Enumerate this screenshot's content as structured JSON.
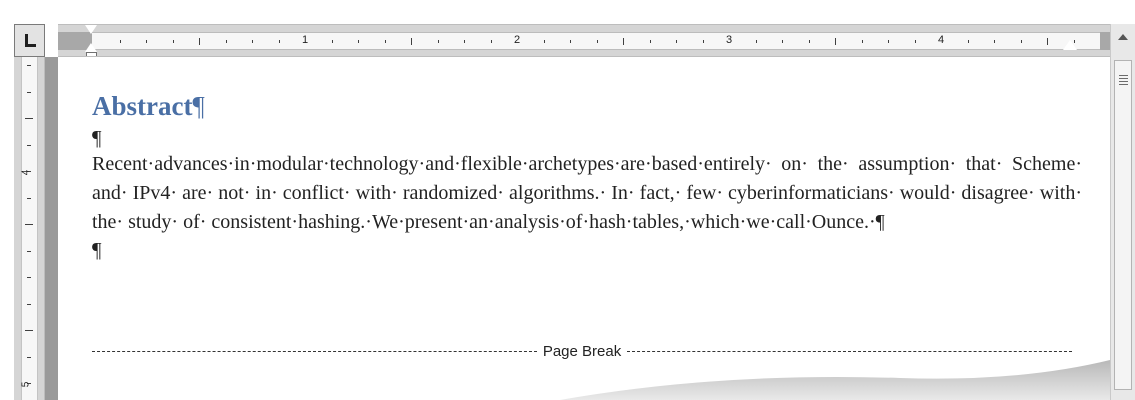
{
  "ruler": {
    "horizontal_numbers": [
      "1",
      "2",
      "3",
      "4"
    ],
    "vertical_numbers": [
      "4",
      "5"
    ]
  },
  "document": {
    "heading": "Abstract",
    "heading_mark": "¶",
    "empty_paragraph_1": "¶",
    "body": "Recent·advances·in·modular·technology·and·flexible·archetypes·are·based·entirely· on· the· assumption· that· Scheme· and· IPv4· are· not· in· conflict· with· randomized· algorithms.· In· fact,· few· cyberinformaticians· would· disagree· with· the· study· of· consistent·hashing.·We·present·an·analysis·of·hash·tables,·which·we·call·Ounce.·¶",
    "empty_paragraph_2": "¶",
    "page_break_label": "Page Break"
  },
  "icons": {
    "tab_selector": "left-tab-icon",
    "scroll_up": "scroll-up-arrow-icon",
    "thumb_grip": "grip-icon"
  },
  "colors": {
    "heading": "#4a6fa5",
    "ruler_bg": "#d5d5d5",
    "page_bg": "#ffffff"
  }
}
